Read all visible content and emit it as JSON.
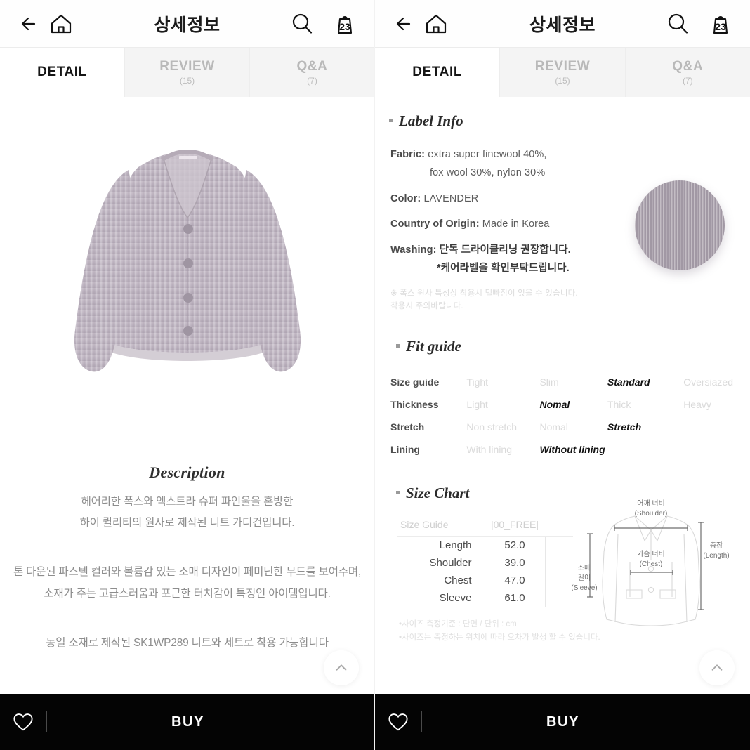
{
  "header": {
    "title": "상세정보",
    "back_icon": "arrow-left-icon",
    "home_icon": "home-icon",
    "search_icon": "search-icon",
    "bag_icon": "shopping-bag-icon",
    "bag_count": "23"
  },
  "tabs": [
    {
      "label": "DETAIL",
      "sub": "",
      "active": true
    },
    {
      "label": "REVIEW",
      "sub": "(15)",
      "active": false
    },
    {
      "label": "Q&A",
      "sub": "(7)",
      "active": false
    }
  ],
  "product": {
    "image_alt": "lavender ribbed knit cardigan",
    "color_hex": "#a9a0ab"
  },
  "description": {
    "title": "Description",
    "paragraph1": [
      "헤어리한 폭스와 엑스트라 슈퍼 파인울을 혼방한",
      "하이 퀄리티의 원사로 제작된 니트 가디건입니다."
    ],
    "paragraph2": [
      "톤 다운된 파스텔 컬러와 볼륨감 있는 소매 디자인이 페미닌한 무드를 보여주며,",
      "소재가 주는 고급스러움과 포근한 터치감이 특징인 아이템입니다."
    ],
    "paragraph3": [
      "동일 소재로 제작된 SK1WP289 니트와 세트로 착용 가능합니다"
    ]
  },
  "label_info": {
    "heading": "Label Info",
    "fabric_key": "Fabric:",
    "fabric_line1": "extra super finewool 40%,",
    "fabric_line2": "fox wool 30%, nylon 30%",
    "color_key": "Color:",
    "color_value": "LAVENDER",
    "origin_key": "Country of Origin:",
    "origin_value": "Made in Korea",
    "washing_key": "Washing:",
    "washing_line1": "단독 드라이클리닝 권장합니다.",
    "washing_line2": "*케어라벨을 확인부탁드립니다.",
    "note_line1": "※ 폭스 원사 특성상 착용시 털빠짐이 있을 수 있습니다.",
    "note_line2": "착용시 주의바랍니다."
  },
  "fit_guide": {
    "heading": "Fit guide",
    "rows": [
      {
        "key": "Size guide",
        "options": [
          "Tight",
          "Slim",
          "Standard",
          "Oversiazed"
        ],
        "selected": 2
      },
      {
        "key": "Thickness",
        "options": [
          "Light",
          "Nomal",
          "Thick",
          "Heavy"
        ],
        "selected": 1
      },
      {
        "key": "Stretch",
        "options": [
          "Non stretch",
          "Nomal",
          "Stretch",
          ""
        ],
        "selected": 2
      },
      {
        "key": "Lining",
        "options": [
          "With lining",
          "Without lining",
          "",
          ""
        ],
        "selected": 1
      }
    ]
  },
  "size_chart": {
    "heading": "Size Chart",
    "col_header_key": "Size Guide",
    "col_header_value": "|00_FREE|",
    "rows": [
      {
        "name": "Length",
        "value": "52.0"
      },
      {
        "name": "Shoulder",
        "value": "39.0"
      },
      {
        "name": "Chest",
        "value": "47.0"
      },
      {
        "name": "Sleeve",
        "value": "61.0"
      }
    ],
    "diagram": {
      "shoulder_kr": "어깨 너비",
      "shoulder_en": "(Shoulder)",
      "chest_kr": "가슴 너비",
      "chest_en": "(Chest)",
      "length_kr": "총장",
      "length_en": "(Length)",
      "sleeve_kr1": "소매",
      "sleeve_kr2": "길이",
      "sleeve_en": "(Sleeve)"
    },
    "footnote_line1": "•사이즈 측정기준 : 단면 / 단위 : cm",
    "footnote_line2": "•사이즈는 측정하는 위치에 따라 오차가 발생 할 수 있습니다."
  },
  "scroll_top": {
    "icon": "chevron-up-icon"
  },
  "bottom_bar": {
    "wishlist_icon": "heart-icon",
    "buy_label": "BUY"
  }
}
